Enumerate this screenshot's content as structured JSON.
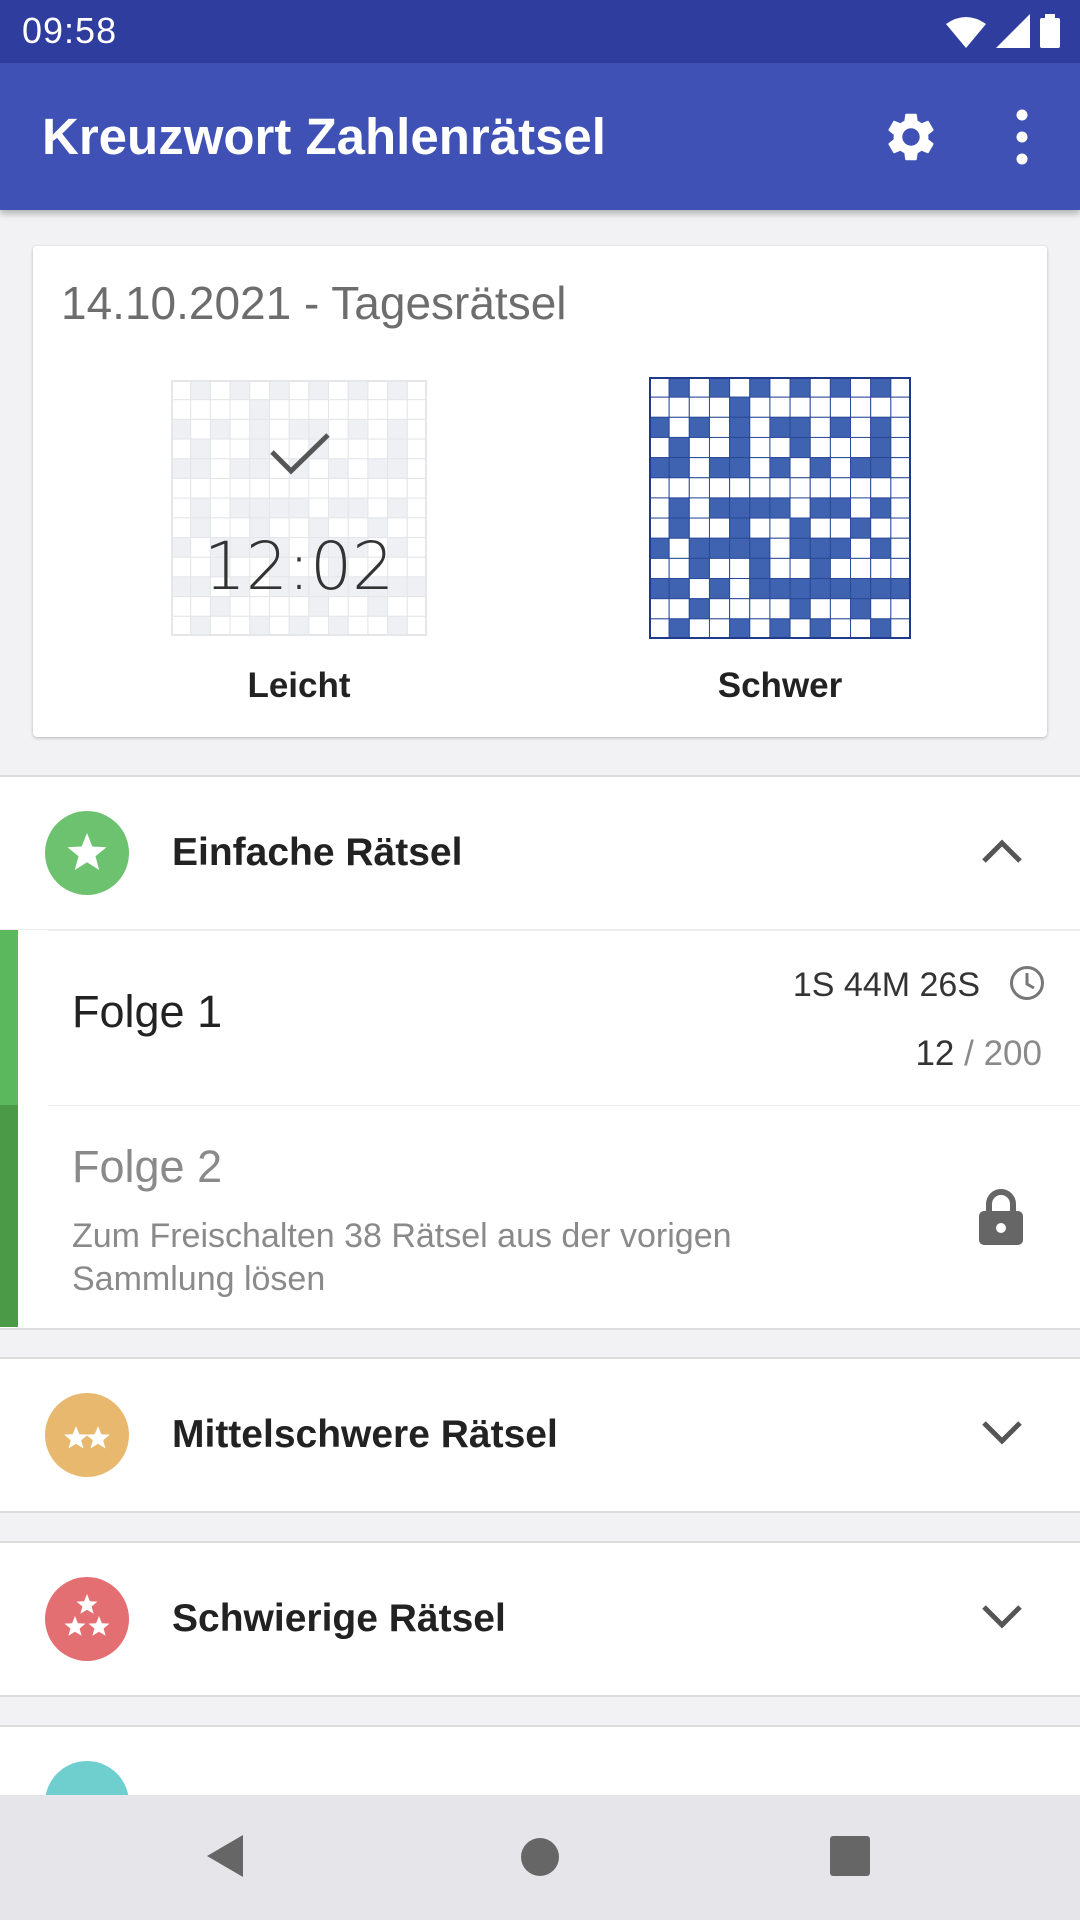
{
  "status_bar": {
    "time": "09:58",
    "icons": [
      "wifi-icon",
      "signal-icon",
      "battery-icon"
    ]
  },
  "app_bar": {
    "title": "Kreuzwort Zahlenrätsel",
    "actions": [
      "gear-icon",
      "more-vert-icon"
    ]
  },
  "daily": {
    "title": "14.10.2021 - Tagesrätsel",
    "easy": {
      "label": "Leicht",
      "time": "12:02",
      "solved": true
    },
    "hard": {
      "label": "Schwer",
      "solved": false
    }
  },
  "sections": {
    "easy": {
      "label": "Einfache Rätsel",
      "color": "#6cc26f",
      "expanded": true,
      "episodes": {
        "folge1": {
          "name": "Folge 1",
          "time": "1S 44M 26S",
          "solved": "12",
          "total": "/ 200",
          "accent": "#5cb85c"
        },
        "folge2": {
          "name": "Folge 2",
          "desc": "Zum Freischalten 38 Rätsel aus der vorigen Sammlung lösen",
          "accent": "#4a9a47"
        }
      }
    },
    "medium": {
      "label": "Mittelschwere Rätsel",
      "color": "#e8b86e",
      "expanded": false
    },
    "hard": {
      "label": "Schwierige Rätsel",
      "color": "#e46f72",
      "expanded": false
    },
    "experts": {
      "color": "#6fcfcf"
    }
  },
  "colors": {
    "status_bar": "#2f3e9e",
    "app_bar": "#3f51b5",
    "puzzle_blue": "#3f63b0"
  }
}
